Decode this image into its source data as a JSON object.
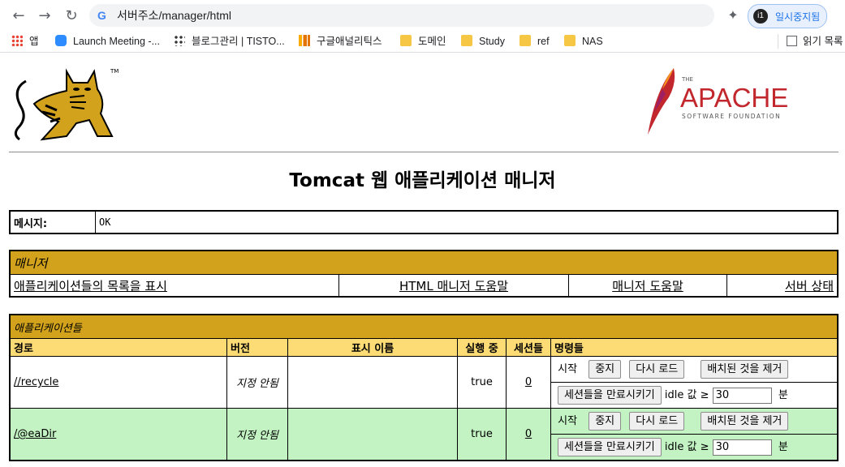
{
  "browser": {
    "url": "서버주소/manager/html",
    "paused_label": "일시중지됨",
    "bookmarks": [
      {
        "label": "앱"
      },
      {
        "label": "Launch Meeting -..."
      },
      {
        "label": "블로그관리 | TISTO..."
      },
      {
        "label": "구글애널리틱스"
      },
      {
        "label": "도메인"
      },
      {
        "label": "Study"
      },
      {
        "label": "ref"
      },
      {
        "label": "NAS"
      }
    ],
    "reading_list": "읽기 목록"
  },
  "page": {
    "title": "Tomcat 웹 애플리케이션 매니저",
    "message_label": "메시지:",
    "message_value": "OK",
    "logos": {
      "apache_small": "THE",
      "apache_main": "APACHE",
      "apache_sub": "SOFTWARE FOUNDATION",
      "tomcat_tm": "TM"
    },
    "manager_section": {
      "heading": "매니저",
      "links": [
        "애플리케이션들의 목록을 표시",
        "HTML 매니저 도움말",
        "매니저 도움말",
        "서버 상태"
      ]
    },
    "apps_section": {
      "heading": "애플리케이션들",
      "columns": [
        "경로",
        "버전",
        "표시 이름",
        "실행 중",
        "세션들",
        "명령들"
      ],
      "rows": [
        {
          "path": "//recycle",
          "version": "지정 안됨",
          "display_name": "",
          "running": "true",
          "sessions": "0"
        },
        {
          "path": "/@eaDir",
          "version": "지정 안됨",
          "display_name": "",
          "running": "true",
          "sessions": "0"
        }
      ],
      "commands": {
        "start": "시작",
        "stop": "중지",
        "reload": "다시 로드",
        "undeploy": "배치된 것을 제거",
        "expire": "세션들을 만료시키기",
        "idle_label": "idle 값 ≥",
        "idle_value": "30",
        "unit": "분"
      }
    }
  },
  "colors": {
    "section_header": "#d2a21c",
    "column_header": "#fedc75",
    "row_green": "#c3f3c3"
  }
}
